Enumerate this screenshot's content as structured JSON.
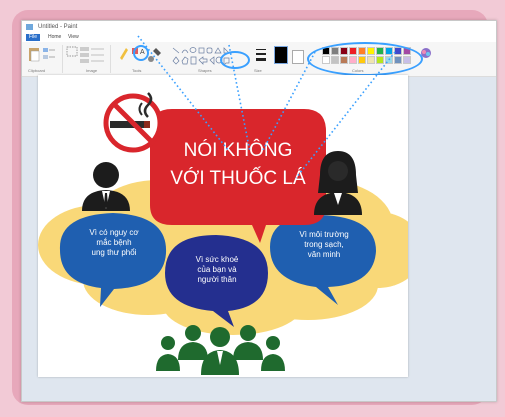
{
  "window": {
    "title": "Untitled - Paint"
  },
  "tabs": {
    "file": "File",
    "home": "Home",
    "view": "View"
  },
  "ribbon": {
    "groups": [
      "Clipboard",
      "Image",
      "Tools",
      "Shapes",
      "Size",
      "Colors"
    ]
  },
  "colors": {
    "palette": [
      "#000000",
      "#7f7f7f",
      "#880015",
      "#ed1c24",
      "#ff7f27",
      "#fff200",
      "#22b14c",
      "#00a2e8",
      "#3f48cc",
      "#a349a4",
      "#ffffff",
      "#c3c3c3",
      "#b97a57",
      "#ffaec9",
      "#ffc90e",
      "#efe4b0",
      "#b5e61d",
      "#99d9ea",
      "#7092be",
      "#c8bfe7"
    ],
    "accent": "#3aa0ff",
    "headline_red": "#d9262c",
    "bubble_blue": "#1f5fb0",
    "bubble_navy": "#242f8f",
    "cloud_yellow": "#f9d878"
  },
  "poster": {
    "headline_line1": "NÓI KHÔNG",
    "headline_line2": "VỚI THUỐC LÁ",
    "left_bubble": "Vì có nguy cơ\nmắc bệnh\nung thư phổi",
    "center_bubble": "Vì sức khoẻ\ncủa bạn và\nngười thân",
    "right_bubble": "Vì môi trường\ntrong sạch,\nvăn minh"
  }
}
